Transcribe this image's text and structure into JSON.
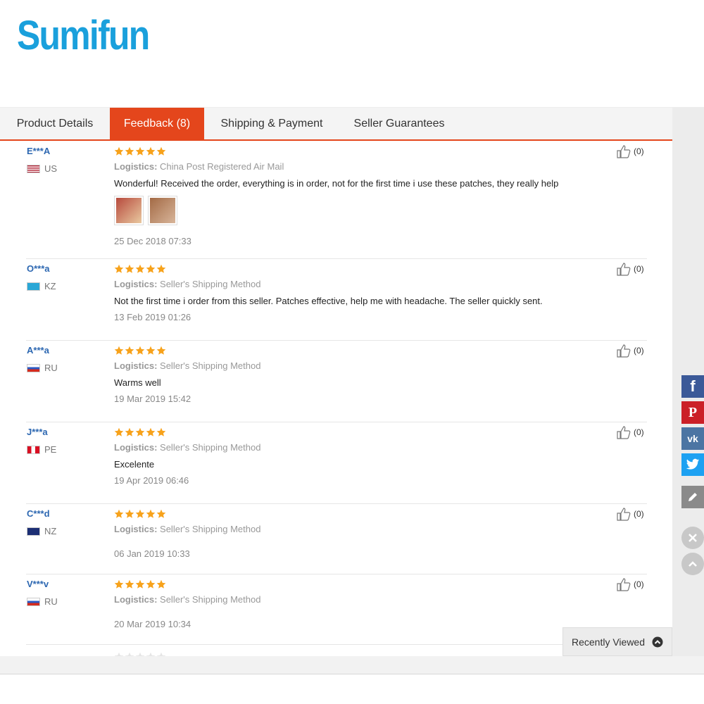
{
  "brand": {
    "logo_text": "Sumifun",
    "color": "#1aa0dc"
  },
  "tabs": [
    {
      "label": "Product Details",
      "active": false
    },
    {
      "label": "Feedback (8)",
      "active": true
    },
    {
      "label": "Shipping & Payment",
      "active": false
    },
    {
      "label": "Seller Guarantees",
      "active": false
    }
  ],
  "accent_color": "#e4461c",
  "logistics_label": "Logistics:",
  "reviews": [
    {
      "user": "E***A",
      "country": "US",
      "rating": 5,
      "logistics": "China Post Registered Air Mail",
      "text": "Wonderful! Received the order, everything is in order, not for the first time i use these patches, they really help",
      "photos": 2,
      "date": "25 Dec 2018 07:33",
      "helpful": "(0)"
    },
    {
      "user": "O***a",
      "country": "KZ",
      "rating": 5,
      "logistics": "Seller's Shipping Method",
      "text": "Not the first time i order from this seller. Patches effective, help me with headache. The seller quickly sent.",
      "date": "13 Feb 2019 01:26",
      "helpful": "(0)"
    },
    {
      "user": "A***a",
      "country": "RU",
      "rating": 5,
      "logistics": "Seller's Shipping Method",
      "text": "Warms well",
      "date": "19 Mar 2019 15:42",
      "helpful": "(0)"
    },
    {
      "user": "J***a",
      "country": "PE",
      "rating": 5,
      "logistics": "Seller's Shipping Method",
      "text": "Excelente",
      "date": "19 Apr 2019 06:46",
      "helpful": "(0)"
    },
    {
      "user": "C***d",
      "country": "NZ",
      "rating": 5,
      "logistics": "Seller's Shipping Method",
      "text": "",
      "date": "06 Jan 2019 10:33",
      "helpful": "(0)"
    },
    {
      "user": "V***v",
      "country": "RU",
      "rating": 5,
      "logistics": "Seller's Shipping Method",
      "text": "",
      "date": "20 Mar 2019 10:34",
      "helpful": "(0)"
    }
  ],
  "share_icons": [
    "facebook-icon",
    "pinterest-icon",
    "vk-icon",
    "twitter-icon",
    "edit-icon"
  ],
  "share_glyphs": {
    "facebook": "f",
    "pinterest": "P",
    "vk": "vk"
  },
  "share_colors": {
    "facebook": "#3b5998",
    "pinterest": "#cb2027",
    "vk": "#4c75a3",
    "twitter": "#1da1f2",
    "edit": "#8a8a8a"
  },
  "recently_viewed": {
    "label": "Recently Viewed"
  },
  "star_color": "#f7a21b"
}
